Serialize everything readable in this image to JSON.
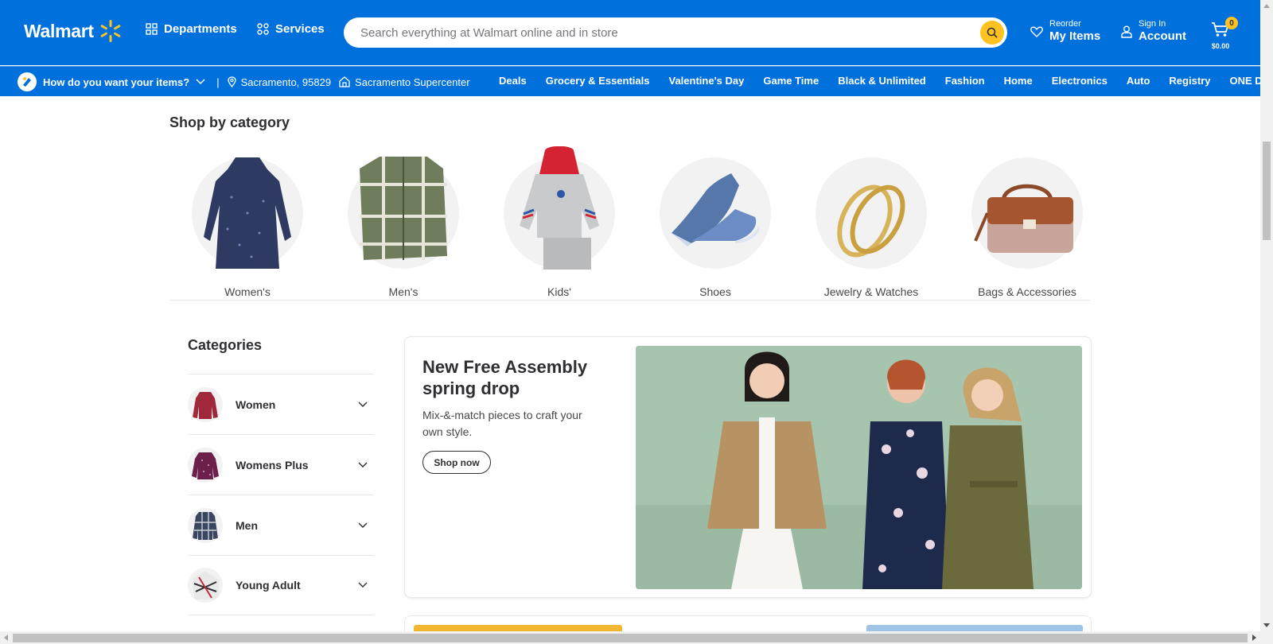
{
  "header": {
    "logo": "Walmart",
    "departments": "Departments",
    "services": "Services",
    "search_placeholder": "Search everything at Walmart online and in store",
    "reorder_small": "Reorder",
    "reorder_big": "My Items",
    "signin_small": "Sign In",
    "signin_big": "Account",
    "cart_count": "0",
    "cart_total": "$0.00"
  },
  "subnav": {
    "question": "How do you want your items?",
    "separator": "|",
    "location": "Sacramento, 95829",
    "store": "Sacramento Supercenter",
    "links": [
      "Deals",
      "Grocery & Essentials",
      "Valentine's Day",
      "Game Time",
      "Black & Unlimited",
      "Fashion",
      "Home",
      "Electronics",
      "Auto",
      "Registry",
      "ONE Debit"
    ]
  },
  "shop_by_category": {
    "title": "Shop by category",
    "items": [
      "Women's",
      "Men's",
      "Kids'",
      "Shoes",
      "Jewelry & Watches",
      "Bags & Accessories"
    ]
  },
  "categories": {
    "title": "Categories",
    "items": [
      "Women",
      "Womens Plus",
      "Men",
      "Young Adult"
    ]
  },
  "banner": {
    "title": "New Free Assembly spring drop",
    "subtitle": "Mix-&-match pieces to craft your own style.",
    "button": "Shop now"
  },
  "colors": {
    "brand_blue": "#0071dc",
    "brand_yellow": "#ffc220"
  }
}
